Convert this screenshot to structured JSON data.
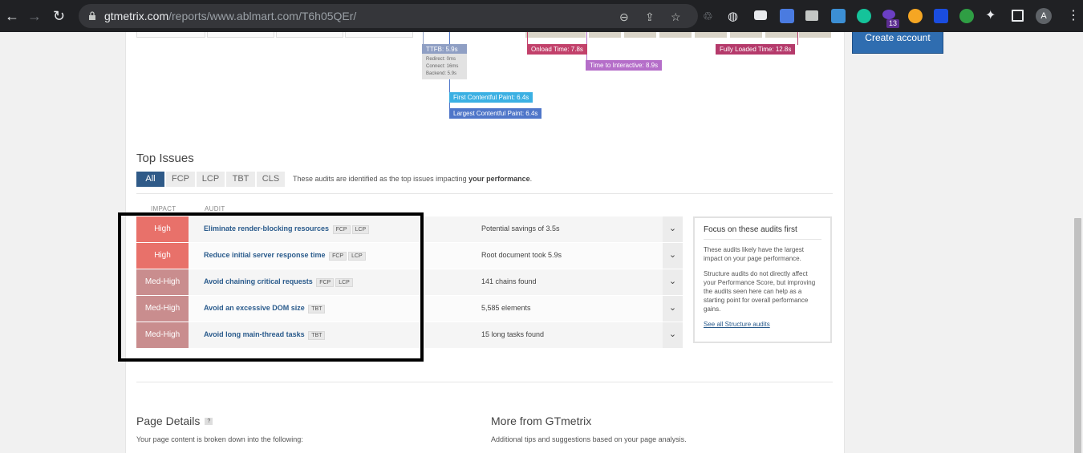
{
  "browser": {
    "url_domain": "gtmetrix.com",
    "url_path": "/reports/www.ablmart.com/T6h05QEr/",
    "extension_badge": "13",
    "avatar_initial": "A"
  },
  "header": {
    "create_account": "Create account"
  },
  "waterfall": {
    "ttfb": "TTFB: 5.9s",
    "ttfb_detail": [
      "Redirect: 0ms",
      "Connect: 16ms",
      "Backend: 5.9s"
    ],
    "onload": "Onload Time: 7.8s",
    "tti": "Time to Interactive: 8.9s",
    "fully_loaded": "Fully Loaded Time: 12.8s",
    "fcp": "First Contentful Paint: 6.4s",
    "lcp": "Largest Contentful Paint: 6.4s",
    "colors": {
      "ttfb": "#8f9fc4",
      "onload": "#c2416b",
      "tti": "#b56ec9",
      "fully": "#b53a6b",
      "fcp": "#3bb0e3",
      "lcp": "#4f76c9"
    }
  },
  "top_issues": {
    "title": "Top Issues",
    "filters": [
      "All",
      "FCP",
      "LCP",
      "TBT",
      "CLS"
    ],
    "active_filter": "All",
    "note_prefix": "These audits are identified as the top issues impacting ",
    "note_bold": "your performance",
    "note_suffix": ".",
    "col_impact": "IMPACT",
    "col_audit": "AUDIT",
    "rows": [
      {
        "impact": "High",
        "audit": "Eliminate render-blocking resources",
        "tags": [
          "FCP",
          "LCP"
        ],
        "result": "Potential savings of 3.5s"
      },
      {
        "impact": "High",
        "audit": "Reduce initial server response time",
        "tags": [
          "FCP",
          "LCP"
        ],
        "result": "Root document took 5.9s"
      },
      {
        "impact": "Med-High",
        "audit": "Avoid chaining critical requests",
        "tags": [
          "FCP",
          "LCP"
        ],
        "result": "141 chains found"
      },
      {
        "impact": "Med-High",
        "audit": "Avoid an excessive DOM size",
        "tags": [
          "TBT"
        ],
        "result": "5,585 elements"
      },
      {
        "impact": "Med-High",
        "audit": "Avoid long main-thread tasks",
        "tags": [
          "TBT"
        ],
        "result": "15 long tasks found"
      }
    ]
  },
  "focus_box": {
    "title": "Focus on these audits first",
    "p1": "These audits likely have the largest impact on your page performance.",
    "p2": "Structure audits do not directly affect your Performance Score, but improving the audits seen here can help as a starting point for overall performance gains.",
    "link": "See all Structure audits"
  },
  "page_details": {
    "title": "Page Details",
    "help": "?",
    "subtitle": "Your page content is broken down into the following:"
  },
  "more": {
    "title": "More from GTmetrix",
    "subtitle": "Additional tips and suggestions based on your page analysis."
  }
}
